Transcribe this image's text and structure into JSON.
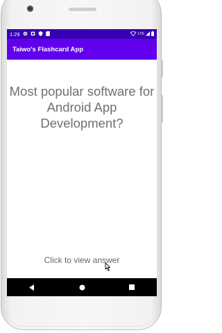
{
  "status_bar": {
    "time": "1:29",
    "left_icons": [
      "settings-icon",
      "notification-icon",
      "shield-icon",
      "sd-card-icon"
    ],
    "right_icons": [
      "wifi-icon",
      "signal-icon",
      "battery-icon"
    ],
    "network_label": "LTE"
  },
  "app_bar": {
    "title": "Taiwo's Flashcard App",
    "color": "#6200ee",
    "status_color": "#3700b3"
  },
  "flashcard": {
    "question": "Most popular software for Android App Development?",
    "answer_prompt": "Click to view answer"
  },
  "nav_bar": {
    "buttons": [
      "back-icon",
      "home-icon",
      "recents-icon"
    ]
  }
}
